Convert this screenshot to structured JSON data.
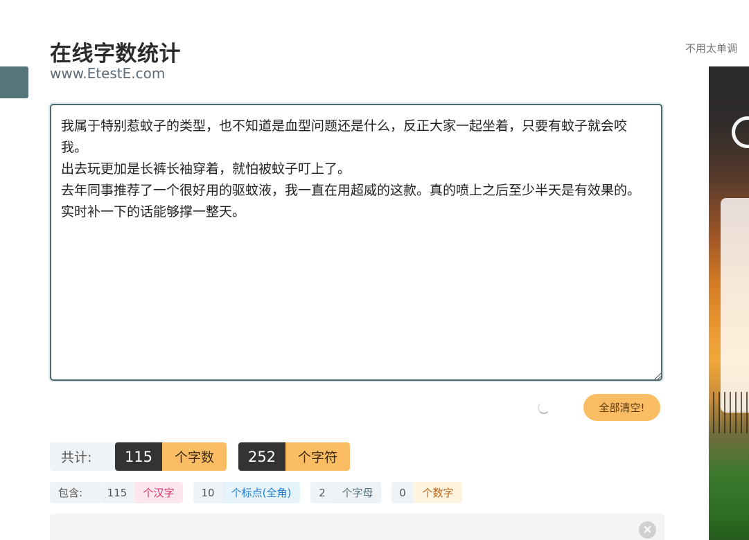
{
  "header": {
    "title": "在线字数统计",
    "subtitle": "www.EtestE.com",
    "top_right_text": "不用太单调"
  },
  "editor": {
    "content": "我属于特别惹蚊子的类型，也不知道是血型问题还是什么，反正大家一起坐着，只要有蚊子就会咬我。\n出去玩更加是长裤长袖穿着，就怕被蚊子叮上了。\n去年同事推荐了一个很好用的驱蚊液，我一直在用超威的这款。真的喷上之后至少半天是有效果的。实时补一下的话能够撑一整天。"
  },
  "actions": {
    "clear_label": "全部清空!"
  },
  "totals": {
    "label": "共计:",
    "words_count": "115",
    "words_unit": "个字数",
    "chars_count": "252",
    "chars_unit": "个字符"
  },
  "details": {
    "label": "包含:",
    "hanzi_count": "115",
    "hanzi_unit": "个汉字",
    "punct_count": "10",
    "punct_unit": "个标点(全角)",
    "letters_count": "2",
    "letters_unit": "个字母",
    "digits_count": "0",
    "digits_unit": "个数字"
  },
  "bottom": {
    "close_symbol": "×"
  },
  "colors": {
    "accent_orange": "#fbbd63",
    "dark": "#333333",
    "teal": "#56757a",
    "hanzi_bg": "#fde7ee",
    "hanzi_fg": "#d6336c",
    "punct_bg": "#e7f3fb",
    "punct_fg": "#1c7ed6",
    "letters_bg": "#eef2f5",
    "letters_fg": "#55707d",
    "digits_bg": "#fff4e0",
    "digits_fg": "#b5651d"
  }
}
